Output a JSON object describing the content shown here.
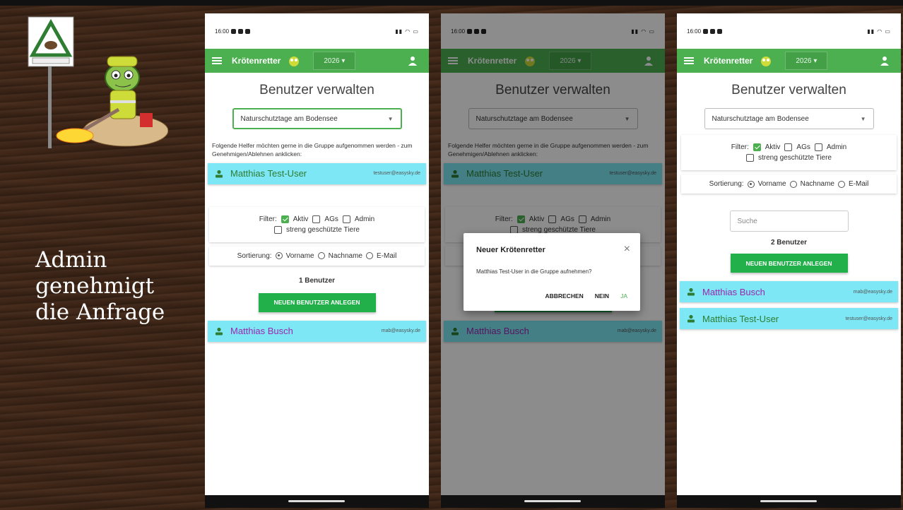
{
  "slide": {
    "caption": "Admin\ngenehmigt\ndie Anfrage"
  },
  "colors": {
    "appbar": "#4caf50",
    "button": "#22b04b",
    "card": "#7de7f5",
    "name_green": "#2e7d32",
    "name_purple": "#9c27b0"
  },
  "statusbar": {
    "time": "16:00"
  },
  "app": {
    "title": "Krötenretter",
    "year": "2026 ▾",
    "menu_icon": "hamburger-icon",
    "account_icon": "person-icon"
  },
  "page": {
    "title": "Benutzer verwalten",
    "group_select": "Naturschutztage am Bodensee",
    "pending_text": "Folgende Helfer möchten gerne in die Gruppe aufgenommen werden - zum Genehmigen/Ablehnen anklicken:",
    "pending_user": {
      "name": "Matthias Test-User",
      "email": "testuser@easysky.de"
    },
    "filter": {
      "label": "Filter:",
      "options": [
        "Aktiv",
        "AGs",
        "Admin",
        "streng geschützte Tiere"
      ]
    },
    "sort": {
      "label": "Sortierung:",
      "options": [
        "Vorname",
        "Nachname",
        "E-Mail"
      ]
    },
    "count_screen1": "1 Benutzer",
    "count_screen3": "2 Benutzer",
    "new_user_button": "NEUEN BENUTZER ANLEGEN",
    "search_placeholder": "Suche",
    "users_screen1": [
      {
        "name": "Matthias Busch",
        "email": "mab@easysky.de"
      }
    ],
    "users_screen3": [
      {
        "name": "Matthias Busch",
        "email": "mab@easysky.de"
      },
      {
        "name": "Matthias Test-User",
        "email": "testuser@easysky.de"
      }
    ]
  },
  "dialog": {
    "title": "Neuer Krötenretter",
    "close": "×",
    "message": "Matthias Test-User in die Gruppe aufnehmen?",
    "cancel": "ABBRECHEN",
    "no": "NEIN",
    "yes": "JA"
  }
}
